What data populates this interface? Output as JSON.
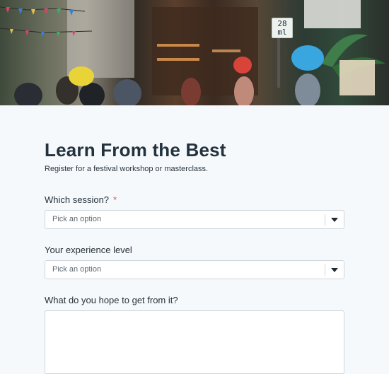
{
  "hero": {
    "price_line1": "28",
    "price_line2": "ml"
  },
  "form": {
    "title": "Learn From the Best",
    "subtitle": "Register for a festival workshop or masterclass.",
    "fields": [
      {
        "label": "Which session?",
        "required_marker": "*",
        "placeholder": "Pick an option",
        "type": "select"
      },
      {
        "label": "Your experience level",
        "placeholder": "Pick an option",
        "type": "select"
      },
      {
        "label": "What do you hope to get from it?",
        "value": "",
        "type": "textarea"
      }
    ]
  },
  "colors": {
    "background": "#f5f9fc",
    "required": "#d9534f",
    "title": "#23323d",
    "border": "#cfd6dc"
  }
}
